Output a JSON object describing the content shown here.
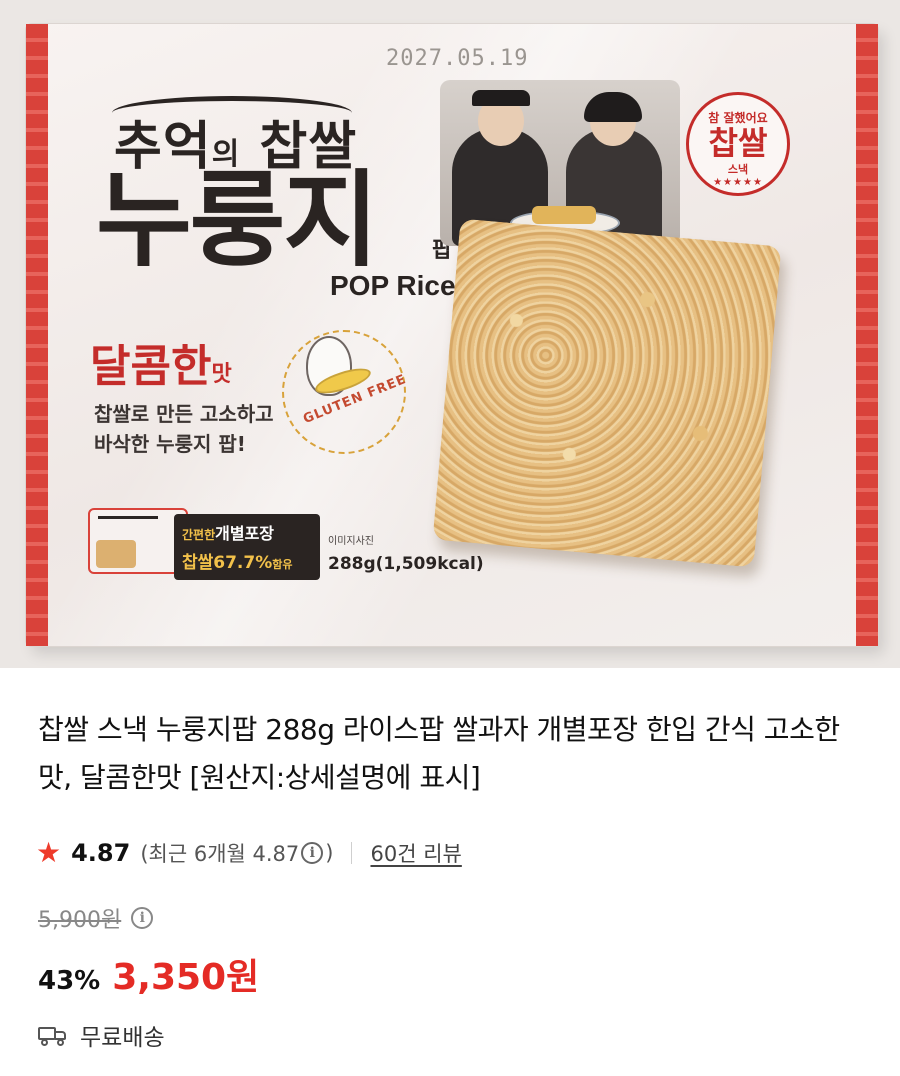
{
  "package": {
    "date_stamp": "2027.05.19",
    "title_line1_a": "추억",
    "title_line1_b": "의",
    "title_line1_c": " 찹쌀",
    "title_line2": "누룽지",
    "title_line2_suffix": "팝",
    "subtitle": "POP Rice",
    "flavor": "달콤한",
    "flavor_suffix": "맛",
    "desc_line1": "찹쌀로 만든 고소하고",
    "desc_line2": "바삭한 누룽지 팝!",
    "gluten": "GLUTEN FREE",
    "badge_top": "참 잘했어요",
    "badge_main": "찹쌀",
    "badge_sub": "스낵",
    "badge_stars": "★★★★★",
    "note_prefix": "간편한",
    "note_main": "개별포장",
    "note_rice": "찹쌀67.7%",
    "note_rice_suffix": "함유",
    "image_note": "이미지사진",
    "weight": "288g(1,509kcal)"
  },
  "product": {
    "title": "찹쌀 스낵 누룽지팝 288g 라이스팝 쌀과자 개별포장 한입 간식 고소한맛, 달콤한맛 [원산지:상세설명에 표시]",
    "rating": "4.87",
    "recent_prefix": "(최근 6개월 4.87",
    "recent_suffix": ")",
    "reviews_link": "60건 리뷰",
    "original_price": "5,900원",
    "discount": "43%",
    "price": "3,350원",
    "shipping": "무료배송",
    "info_glyph": "i",
    "star_glyph": "★"
  },
  "colors": {
    "price_red": "#e42b25",
    "star_red": "#ee3b2b",
    "brand_red": "#c42c2a"
  },
  "icons": [
    "star-icon",
    "info-icon",
    "truck-icon"
  ]
}
